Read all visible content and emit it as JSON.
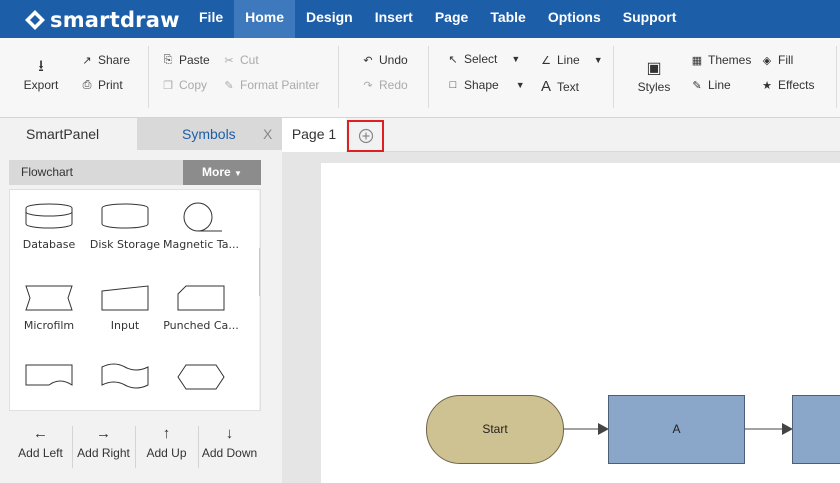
{
  "app": {
    "logo_text": "smartdraw"
  },
  "menu": [
    "File",
    "Home",
    "Design",
    "Insert",
    "Page",
    "Table",
    "Options",
    "Support"
  ],
  "ribbon": {
    "export": "Export",
    "share": "Share",
    "print": "Print",
    "paste": "Paste",
    "copy": "Copy",
    "cut": "Cut",
    "format_painter": "Format Painter",
    "undo": "Undo",
    "redo": "Redo",
    "select": "Select",
    "shape": "Shape",
    "line": "Line",
    "text": "Text",
    "styles": "Styles",
    "themes": "Themes",
    "line2": "Line",
    "fill": "Fill",
    "effects": "Effects"
  },
  "panel": {
    "smartpanel_tab": "SmartPanel",
    "symbols_tab": "Symbols",
    "close": "X",
    "library": "Flowchart",
    "more": "More",
    "shapes": [
      {
        "label": "Database"
      },
      {
        "label": "Disk Storage"
      },
      {
        "label": "Magnetic Ta..."
      },
      {
        "label": "Microfilm"
      },
      {
        "label": "Input"
      },
      {
        "label": "Punched Ca..."
      }
    ],
    "add_buttons": [
      "Add Left",
      "Add Right",
      "Add Up",
      "Add Down"
    ]
  },
  "canvas": {
    "page_tab": "Page 1",
    "nodes": {
      "start": "Start",
      "a": "A"
    }
  },
  "colors": {
    "brand": "#1d5ea8",
    "start_fill": "#cfc292",
    "process_fill": "#8aa7c9",
    "highlight": "#e02020"
  }
}
